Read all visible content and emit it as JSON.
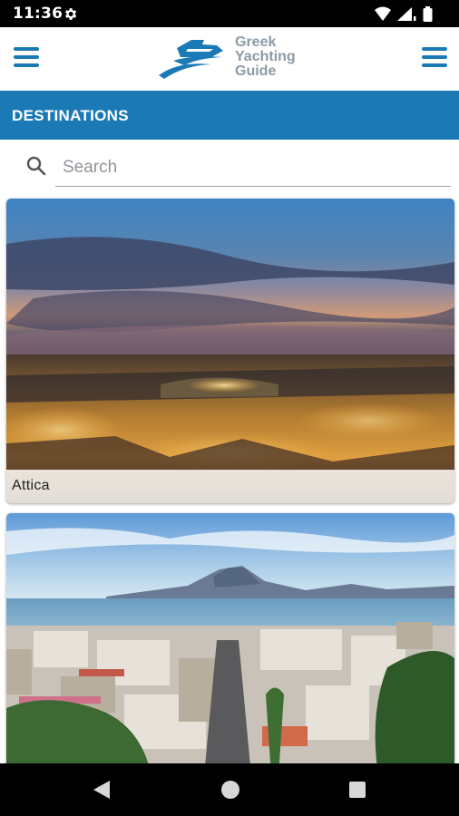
{
  "status_bar": {
    "time": "11:36",
    "icons": [
      "gear-icon",
      "wifi-icon",
      "signal-icon",
      "battery-icon"
    ]
  },
  "app_bar": {
    "logo_lines": [
      "Greek",
      "Yachting",
      "Guide"
    ],
    "left_icon": "menu-icon",
    "right_icon": "menu-icon"
  },
  "title_bar": {
    "title": "DESTINATIONS"
  },
  "search": {
    "placeholder": "Search",
    "value": ""
  },
  "destinations": [
    {
      "name": "Attica"
    },
    {
      "name": ""
    }
  ],
  "nav_bar": {
    "buttons": [
      "back-icon",
      "home-icon",
      "recents-icon"
    ]
  },
  "colors": {
    "brand": "#1b7ab6",
    "logo_text": "#8c9ba5"
  }
}
